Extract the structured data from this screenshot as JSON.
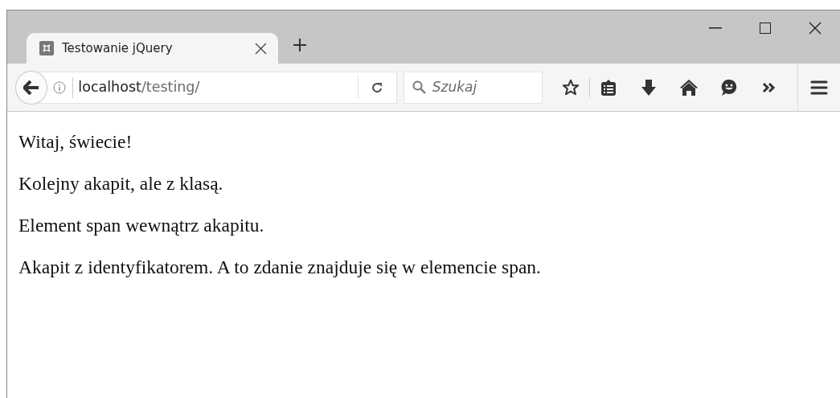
{
  "tabs": [
    {
      "title": "Testowanie jQuery",
      "selected": true
    }
  ],
  "address_bar": {
    "host": "localhost",
    "path": "/testing/"
  },
  "search": {
    "placeholder": "Szukaj"
  },
  "page": {
    "paragraphs": [
      "Witaj, świecie!",
      "Kolejny akapit, ale z klasą.",
      "Element span wewnątrz akapitu.",
      "Akapit z identyfikatorem. A to zdanie znajduje się w elemencie span."
    ]
  }
}
